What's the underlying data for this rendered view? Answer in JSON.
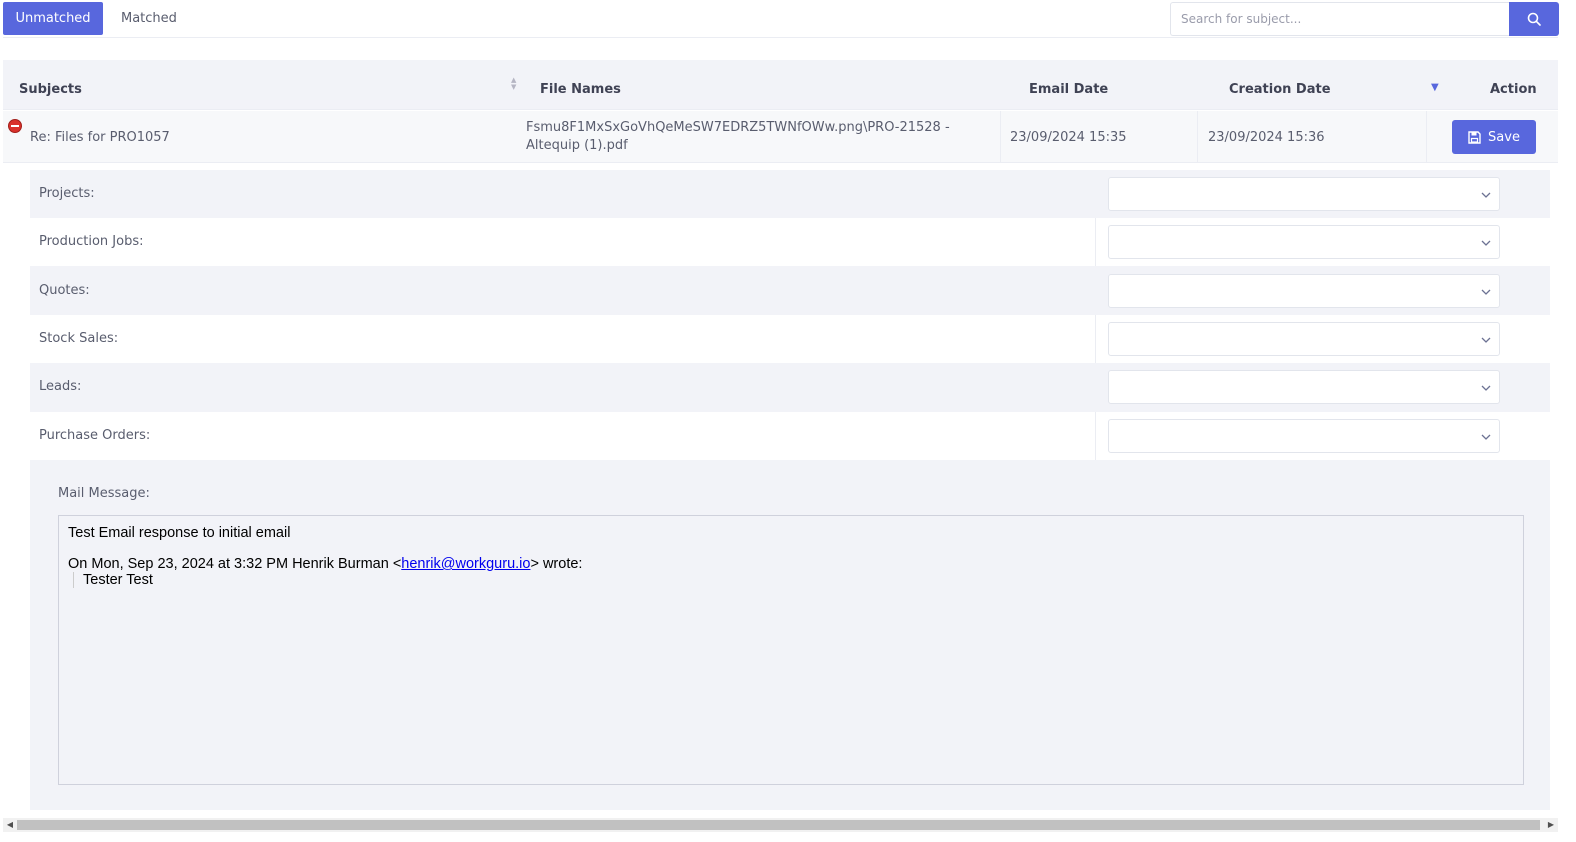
{
  "tabs": {
    "unmatched": "Unmatched",
    "matched": "Matched"
  },
  "search": {
    "placeholder": "Search for subject...",
    "value": ""
  },
  "table": {
    "headers": {
      "subjects": "Subjects",
      "file_names": "File Names",
      "email_date": "Email Date",
      "creation_date": "Creation Date",
      "action": "Action"
    },
    "row": {
      "subject": "Re: Files for PRO1057",
      "file_name": "Fsmu8F1MxSxGoVhQeMeSW7EDRZ5TWNfOWw.png\\PRO-21528 - Altequip (1).pdf",
      "email_date": "23/09/2024 15:35",
      "creation_date": "23/09/2024 15:36",
      "save_label": "Save"
    }
  },
  "detail": {
    "fields": [
      {
        "label": "Projects:"
      },
      {
        "label": "Production Jobs:"
      },
      {
        "label": "Quotes:"
      },
      {
        "label": "Stock Sales:"
      },
      {
        "label": "Leads:"
      },
      {
        "label": "Purchase Orders:"
      }
    ],
    "mail_label": "Mail Message:",
    "mail": {
      "line1": "Test Email response to initial email",
      "line2_prefix": "On Mon, Sep 23, 2024 at 3:32 PM Henrik Burman <",
      "line2_link": "henrik@workguru.io",
      "line2_suffix": "> wrote:",
      "quote": "Tester Test"
    }
  },
  "colors": {
    "accent": "#5867dd",
    "header_bg": "#f2f3f8",
    "danger": "#d9312b"
  },
  "icons": {
    "search": "search-icon",
    "save": "floppy-disk-icon",
    "collapse": "minus-circle-icon",
    "dropdown": "chevron-down-icon"
  }
}
